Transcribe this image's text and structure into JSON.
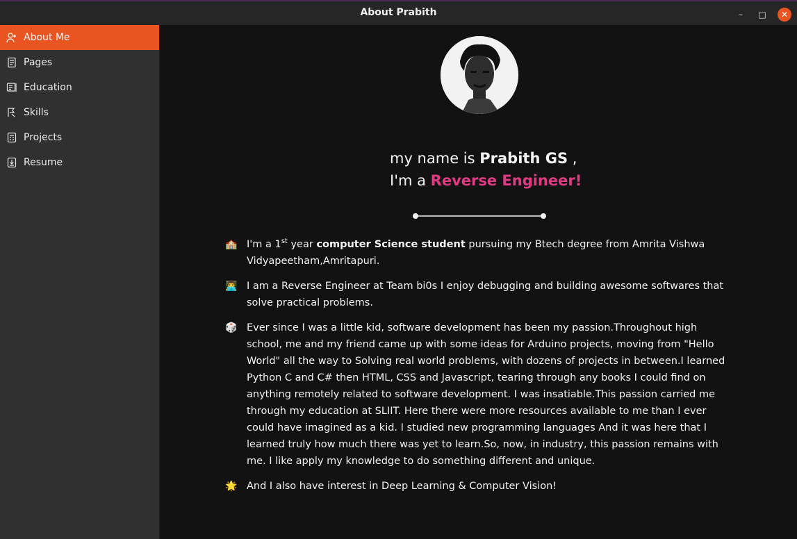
{
  "window": {
    "title": "About Prabith",
    "controls": {
      "minimize": "–",
      "maximize": "□",
      "close": "✕"
    }
  },
  "sidebar": {
    "items": [
      {
        "label": "About Me",
        "icon": "user-add-icon",
        "active": true
      },
      {
        "label": "Pages",
        "icon": "pages-icon",
        "active": false
      },
      {
        "label": "Education",
        "icon": "education-icon",
        "active": false
      },
      {
        "label": "Skills",
        "icon": "skills-icon",
        "active": false
      },
      {
        "label": "Projects",
        "icon": "projects-icon",
        "active": false
      },
      {
        "label": "Resume",
        "icon": "resume-download-icon",
        "active": false
      }
    ]
  },
  "intro": {
    "line1_prefix": "my name is",
    "name": "Prabith GS",
    "line1_suffix": ",",
    "line2_prefix": "I'm a",
    "role": "Reverse Engineer!"
  },
  "about_items": [
    {
      "emoji": "🏫",
      "p1": "I'm a 1",
      "sup": "st",
      "p2": " year ",
      "bold": "computer Science student",
      "p3": " pursuing my Btech degree from Amrita Vishwa Vidyapeetham,Amritapuri."
    },
    {
      "emoji": "👨‍💻",
      "text": "I am a Reverse Engineer at Team bi0s I enjoy debugging and building awesome softwares that solve practical problems."
    },
    {
      "emoji": "🎲",
      "text": "Ever since I was a little kid, software development has been my passion.Throughout high school, me and my friend came up with some ideas for Arduino projects, moving from \"Hello World\" all the way to Solving real world problems, with dozens of projects in between.I learned Python C and C# then HTML, CSS and Javascript, tearing through any books I could find on anything remotely related to software development. I was insatiable.This passion carried me through my education at SLIIT. Here there were more resources available to me than I ever could have imagined as a kid. I studied new programming languages And it was here that I learned truly how much there was yet to learn.So, now, in industry, this passion remains with me. I like apply my knowledge to do something different and unique."
    },
    {
      "emoji": "🌟",
      "text": "And I also have interest in Deep Learning & Computer Vision!"
    }
  ],
  "colors": {
    "accent": "#e95420",
    "role_highlight": "#e13a84",
    "sidebar_bg": "#303030",
    "content_bg": "#121212"
  }
}
